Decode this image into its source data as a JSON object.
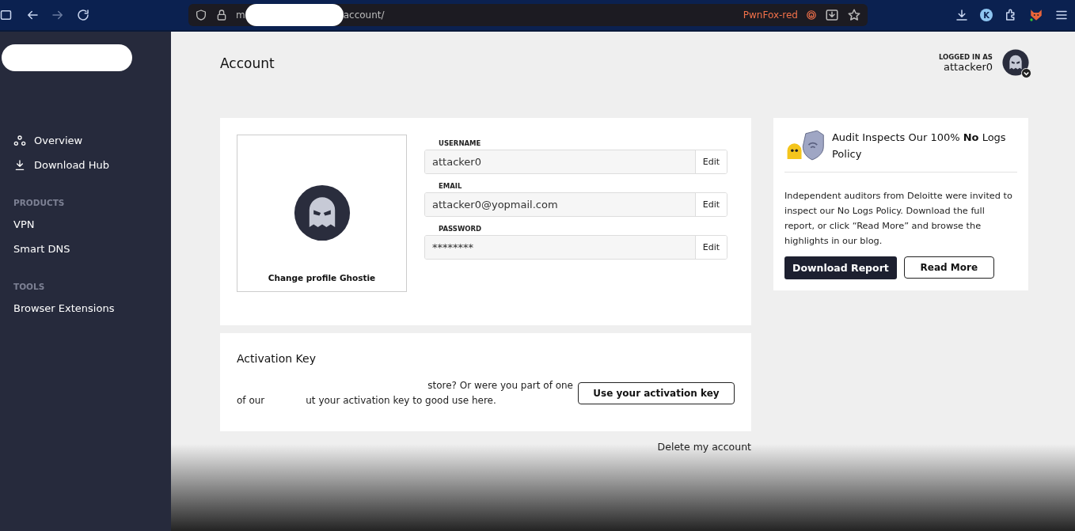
{
  "browser": {
    "url_start": "m",
    "url_end": "account/",
    "container_label": "PwnFox-red",
    "profile_letter": "K"
  },
  "sidebar": {
    "items": [
      {
        "kind": "nav",
        "label": "Overview"
      },
      {
        "kind": "nav",
        "label": "Download Hub"
      },
      {
        "kind": "heading",
        "label": "PRODUCTS"
      },
      {
        "kind": "nav",
        "label": "VPN"
      },
      {
        "kind": "nav",
        "label": "Smart DNS"
      },
      {
        "kind": "heading",
        "label": "TOOLS"
      },
      {
        "kind": "nav",
        "label": "Browser Extensions"
      }
    ]
  },
  "header": {
    "title": "Account",
    "logged_in_label": "LOGGED IN AS",
    "user": "attacker0"
  },
  "profile": {
    "change_label": "Change profile Ghostie",
    "fields": [
      {
        "label": "USERNAME",
        "value": "attacker0",
        "action": "Edit"
      },
      {
        "label": "EMAIL",
        "value": "attacker0@yopmail.com",
        "action": "Edit"
      },
      {
        "label": "PASSWORD",
        "value": "********",
        "action": "Edit"
      }
    ]
  },
  "activation": {
    "title": "Activation Key",
    "lines": [
      "store? Or were you part of one",
      "of our",
      "ut your activation key to good use here."
    ],
    "button": "Use your activation key"
  },
  "delete_link": "Delete my account",
  "promo": {
    "title": "Audit Inspects Our 100% **No** Logs Policy",
    "body": "Independent auditors from Deloitte were invited to inspect our No Logs Policy. Download the full report, or click “Read More” and browse the highlights in our blog.",
    "primary": "Download Report",
    "secondary": "Read More"
  }
}
